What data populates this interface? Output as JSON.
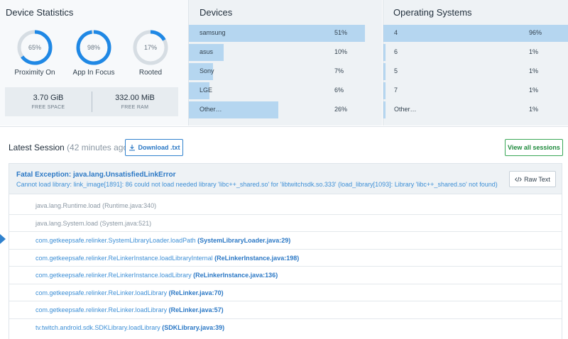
{
  "device_statistics": {
    "title": "Device Statistics",
    "gauges": [
      {
        "label": "Proximity On",
        "value": "65%",
        "fraction": 0.65
      },
      {
        "label": "App In Focus",
        "value": "98%",
        "fraction": 0.98
      },
      {
        "label": "Rooted",
        "value": "17%",
        "fraction": 0.17
      }
    ],
    "free_space": {
      "value": "3.70 GiB",
      "label": "FREE SPACE"
    },
    "free_ram": {
      "value": "332.00 MiB",
      "label": "FREE RAM"
    }
  },
  "devices": {
    "title": "Devices",
    "rows": [
      {
        "name": "samsung",
        "pct": "51%",
        "fraction": 0.51
      },
      {
        "name": "asus",
        "pct": "10%",
        "fraction": 0.1
      },
      {
        "name": "Sony",
        "pct": "7%",
        "fraction": 0.07
      },
      {
        "name": "LGE",
        "pct": "6%",
        "fraction": 0.06
      },
      {
        "name": "Other…",
        "pct": "26%",
        "fraction": 0.26
      }
    ]
  },
  "operating_systems": {
    "title": "Operating Systems",
    "rows": [
      {
        "name": "4",
        "pct": "96%",
        "fraction": 0.96
      },
      {
        "name": "6",
        "pct": "1%",
        "fraction": 0.01
      },
      {
        "name": "5",
        "pct": "1%",
        "fraction": 0.01
      },
      {
        "name": "7",
        "pct": "1%",
        "fraction": 0.01
      },
      {
        "name": "Other…",
        "pct": "1%",
        "fraction": 0.01
      }
    ]
  },
  "session": {
    "title": "Latest Session",
    "age": "(42 minutes ago)",
    "download_label": "Download .txt",
    "view_all_label": "View all sessions"
  },
  "exception": {
    "title": "Fatal Exception: java.lang.UnsatisfiedLinkError",
    "message": "Cannot load library: link_image[1891]: 86 could not load needed library 'libc++_shared.so' for 'libtwitchsdk.so.333' (load_library[1093]: Library 'libc++_shared.so' not found)",
    "raw_text_label": "Raw Text",
    "frames": [
      {
        "method": "java.lang.Runtime.load",
        "file": "(Runtime.java:340)"
      },
      {
        "method": "java.lang.System.load",
        "file": "(System.java:521)"
      },
      {
        "method": "com.getkeepsafe.relinker.SystemLibraryLoader.loadPath",
        "file": "(SystemLibraryLoader.java:29)"
      },
      {
        "method": "com.getkeepsafe.relinker.ReLinkerInstance.loadLibraryInternal",
        "file": "(ReLinkerInstance.java:198)"
      },
      {
        "method": "com.getkeepsafe.relinker.ReLinkerInstance.loadLibrary",
        "file": "(ReLinkerInstance.java:136)"
      },
      {
        "method": "com.getkeepsafe.relinker.ReLinker.loadLibrary",
        "file": "(ReLinker.java:70)"
      },
      {
        "method": "com.getkeepsafe.relinker.ReLinker.loadLibrary",
        "file": "(ReLinker.java:57)"
      },
      {
        "method": "tv.twitch.android.sdk.SDKLibrary.loadLibrary",
        "file": "(SDKLibrary.java:39)"
      }
    ]
  },
  "colors": {
    "accent": "#3182ce",
    "bar_fill": "#b5d6f0",
    "success": "#3aa757"
  }
}
